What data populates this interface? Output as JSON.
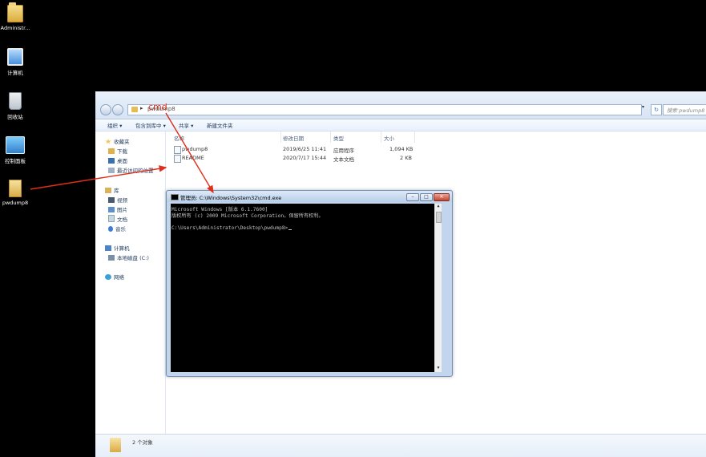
{
  "desktop": {
    "icons": [
      {
        "label": "Administr...",
        "icon": "user-folder-icon"
      },
      {
        "label": "计算机",
        "icon": "computer-icon"
      },
      {
        "label": "回收站",
        "icon": "recycle-bin-icon"
      },
      {
        "label": "控制面板",
        "icon": "control-panel-icon"
      },
      {
        "label": "pwdump8",
        "icon": "folder-icon"
      }
    ]
  },
  "explorer": {
    "address_path": "pwdump8",
    "search_placeholder": "搜索 pwdump8",
    "toolbar": {
      "organize": "组织 ▾",
      "include_library": "包含到库中 ▾",
      "share": "共享 ▾",
      "new_folder": "新建文件夹"
    },
    "nav": {
      "favorites": "收藏夹",
      "downloads": "下载",
      "desktop": "桌面",
      "recent": "最近访问的位置",
      "libraries": "库",
      "videos": "视频",
      "pictures": "图片",
      "documents": "文档",
      "music": "音乐",
      "computer": "计算机",
      "local_disk": "本地磁盘 (C:)",
      "network": "网络"
    },
    "columns": {
      "name": "名称",
      "modified": "修改日期",
      "type": "类型",
      "size": "大小"
    },
    "files": [
      {
        "name": "pwdump8",
        "modified": "2019/6/25 11:41",
        "type": "应用程序",
        "size": "1,094 KB"
      },
      {
        "name": "README",
        "modified": "2020/7/17 15:44",
        "type": "文本文档",
        "size": "2 KB"
      }
    ],
    "status": "2 个对象"
  },
  "cmd": {
    "title": "管理员: C:\\Windows\\System32\\cmd.exe",
    "lines": [
      "Microsoft Windows [版本 6.1.7600]",
      "版权所有 (c) 2009 Microsoft Corporation。保留所有权利。",
      "",
      "C:\\Users\\Administrator\\Desktop\\pwdump8>"
    ]
  },
  "annotation": {
    "text": "cmd",
    "color": "#e02d1c"
  }
}
